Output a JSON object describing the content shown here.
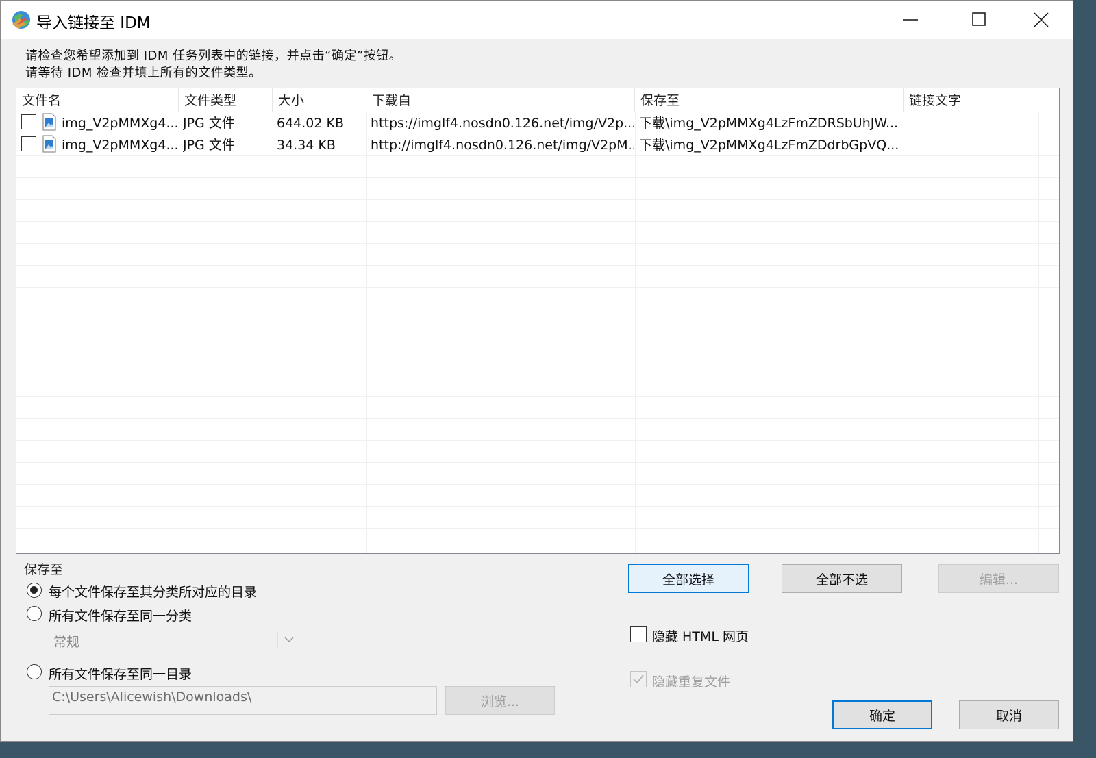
{
  "window": {
    "title": "导入链接至 IDM"
  },
  "instructions": [
    "请检查您希望添加到 IDM 任务列表中的链接，并点击“确定”按钮。",
    "请等待 IDM 检查并填上所有的文件类型。"
  ],
  "table": {
    "columns": [
      "文件名",
      "文件类型",
      "大小",
      "下载自",
      "保存至",
      "链接文字"
    ],
    "rows": [
      {
        "checked": false,
        "filename": "img_V2pMMXg4...",
        "type": "JPG 文件",
        "size": "644.02  KB",
        "from": "https://imglf4.nosdn0.126.net/img/V2p...",
        "saveto": "下载\\img_V2pMMXg4LzFmZDRSbUhJW...",
        "linktext": ""
      },
      {
        "checked": false,
        "filename": "img_V2pMMXg4...",
        "type": "JPG 文件",
        "size": "34.34  KB",
        "from": "http://imglf4.nosdn0.126.net/img/V2pM...",
        "saveto": "下载\\img_V2pMMXg4LzFmZDdrbGpVQ...",
        "linktext": ""
      }
    ]
  },
  "save_group": {
    "label": "保存至",
    "options": [
      {
        "label": "每个文件保存至其分类所对应的目录",
        "selected": true
      },
      {
        "label": "所有文件保存至同一分类",
        "selected": false
      },
      {
        "label": "所有文件保存至同一目录",
        "selected": false
      }
    ],
    "category_select": {
      "value": "常规"
    },
    "directory": {
      "value": "C:\\Users\\Alicewish\\Downloads\\"
    },
    "browse_label": "浏览..."
  },
  "buttons": {
    "select_all": "全部选择",
    "select_none": "全部不选",
    "edit": "编辑...",
    "ok": "确定",
    "cancel": "取消"
  },
  "checkboxes": {
    "hide_html": {
      "label": "隐藏 HTML 网页",
      "checked": false
    },
    "hide_duplicates": {
      "label": "隐藏重复文件",
      "checked": true,
      "disabled": true
    }
  },
  "colors": {
    "accent": "#0078d7"
  }
}
